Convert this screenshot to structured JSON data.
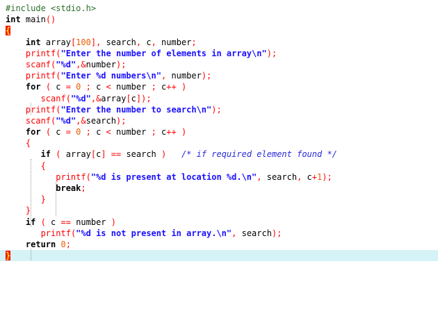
{
  "editor": {
    "lines": [
      [
        [
          "pre",
          "#include <stdio.h>"
        ]
      ],
      [
        [
          "kw",
          "int "
        ],
        [
          "id",
          "main"
        ],
        [
          "op",
          "()"
        ]
      ],
      [
        [
          "bracehl",
          "{"
        ]
      ],
      [
        [
          "ws",
          "    "
        ],
        [
          "kw",
          "int "
        ],
        [
          "id",
          "array"
        ],
        [
          "op",
          "["
        ],
        [
          "num",
          "100"
        ],
        [
          "op",
          "], "
        ],
        [
          "id",
          "search"
        ],
        [
          "op",
          ", "
        ],
        [
          "id",
          "c"
        ],
        [
          "op",
          ", "
        ],
        [
          "id",
          "number"
        ],
        [
          "op",
          ";"
        ]
      ],
      [
        [
          "ws",
          "    "
        ],
        [
          "fn",
          "printf"
        ],
        [
          "op",
          "("
        ],
        [
          "str",
          "\"Enter the number of elements in array\\n\""
        ],
        [
          "op",
          ");"
        ]
      ],
      [
        [
          "ws",
          "    "
        ],
        [
          "fn",
          "scanf"
        ],
        [
          "op",
          "("
        ],
        [
          "str",
          "\"%d\""
        ],
        [
          "op",
          ",&"
        ],
        [
          "id",
          "number"
        ],
        [
          "op",
          ");"
        ]
      ],
      [
        [
          "ws",
          "    "
        ],
        [
          "fn",
          "printf"
        ],
        [
          "op",
          "("
        ],
        [
          "str",
          "\"Enter %d numbers\\n\""
        ],
        [
          "op",
          ", "
        ],
        [
          "id",
          "number"
        ],
        [
          "op",
          ");"
        ]
      ],
      [
        [
          "ws",
          "    "
        ],
        [
          "kw",
          "for "
        ],
        [
          "op",
          "( "
        ],
        [
          "id",
          "c "
        ],
        [
          "op",
          "= "
        ],
        [
          "num",
          "0"
        ],
        [
          "op",
          " ; "
        ],
        [
          "id",
          "c "
        ],
        [
          "op",
          "< "
        ],
        [
          "id",
          "number"
        ],
        [
          "op",
          " ; "
        ],
        [
          "id",
          "c"
        ],
        [
          "op",
          "++ )"
        ]
      ],
      [
        [
          "ws",
          "       "
        ],
        [
          "fn",
          "scanf"
        ],
        [
          "op",
          "("
        ],
        [
          "str",
          "\"%d\""
        ],
        [
          "op",
          ",&"
        ],
        [
          "id",
          "array"
        ],
        [
          "op",
          "["
        ],
        [
          "id",
          "c"
        ],
        [
          "op",
          "]);"
        ]
      ],
      [
        [
          "ws",
          "    "
        ],
        [
          "fn",
          "printf"
        ],
        [
          "op",
          "("
        ],
        [
          "str",
          "\"Enter the number to search\\n\""
        ],
        [
          "op",
          ");"
        ]
      ],
      [
        [
          "ws",
          "    "
        ],
        [
          "fn",
          "scanf"
        ],
        [
          "op",
          "("
        ],
        [
          "str",
          "\"%d\""
        ],
        [
          "op",
          ",&"
        ],
        [
          "id",
          "search"
        ],
        [
          "op",
          ");"
        ]
      ],
      [
        [
          "ws",
          "    "
        ],
        [
          "kw",
          "for "
        ],
        [
          "op",
          "( "
        ],
        [
          "id",
          "c "
        ],
        [
          "op",
          "= "
        ],
        [
          "num",
          "0"
        ],
        [
          "op",
          " ; "
        ],
        [
          "id",
          "c "
        ],
        [
          "op",
          "< "
        ],
        [
          "id",
          "number"
        ],
        [
          "op",
          " ; "
        ],
        [
          "id",
          "c"
        ],
        [
          "op",
          "++ )"
        ]
      ],
      [
        [
          "ws",
          "    "
        ],
        [
          "op",
          "{"
        ]
      ],
      [
        [
          "ws",
          "       "
        ],
        [
          "kw",
          "if "
        ],
        [
          "op",
          "( "
        ],
        [
          "id",
          "array"
        ],
        [
          "op",
          "["
        ],
        [
          "id",
          "c"
        ],
        [
          "op",
          "] == "
        ],
        [
          "id",
          "search"
        ],
        [
          "op",
          " )"
        ],
        [
          "ws",
          "   "
        ],
        [
          "cmt",
          "/* if required element found */"
        ]
      ],
      [
        [
          "ws",
          "       "
        ],
        [
          "op",
          "{"
        ]
      ],
      [
        [
          "ws",
          "          "
        ],
        [
          "fn",
          "printf"
        ],
        [
          "op",
          "("
        ],
        [
          "str",
          "\"%d is present at location %d.\\n\""
        ],
        [
          "op",
          ", "
        ],
        [
          "id",
          "search"
        ],
        [
          "op",
          ", "
        ],
        [
          "id",
          "c"
        ],
        [
          "op",
          "+"
        ],
        [
          "num",
          "1"
        ],
        [
          "op",
          ");"
        ]
      ],
      [
        [
          "ws",
          "          "
        ],
        [
          "kw",
          "break"
        ],
        [
          "op",
          ";"
        ]
      ],
      [
        [
          "ws",
          "       "
        ],
        [
          "op",
          "}"
        ]
      ],
      [
        [
          "ws",
          "    "
        ],
        [
          "op",
          "}"
        ]
      ],
      [
        [
          "ws",
          "    "
        ],
        [
          "kw",
          "if "
        ],
        [
          "op",
          "( "
        ],
        [
          "id",
          "c "
        ],
        [
          "op",
          "== "
        ],
        [
          "id",
          "number"
        ],
        [
          "op",
          " )"
        ]
      ],
      [
        [
          "ws",
          "       "
        ],
        [
          "fn",
          "printf"
        ],
        [
          "op",
          "("
        ],
        [
          "str",
          "\"%d is not present in array.\\n\""
        ],
        [
          "op",
          ", "
        ],
        [
          "id",
          "search"
        ],
        [
          "op",
          ");"
        ]
      ],
      [
        [
          "ws",
          "    "
        ],
        [
          "kw",
          "return "
        ],
        [
          "num",
          "0"
        ],
        [
          "op",
          ";"
        ]
      ],
      [
        [
          "bracehl",
          "}"
        ]
      ]
    ],
    "current_line_index": 22
  },
  "colors": {
    "preprocessor": "#2c6e2c",
    "keyword": "#000000",
    "number": "#e85d00",
    "string": "#1a10ff",
    "operator": "#ff0000",
    "comment": "#2929d9",
    "brace_highlight_bg": "#ff0000",
    "brace_highlight_fg": "#ffff00",
    "current_line_bg": "#d5f2f7"
  }
}
